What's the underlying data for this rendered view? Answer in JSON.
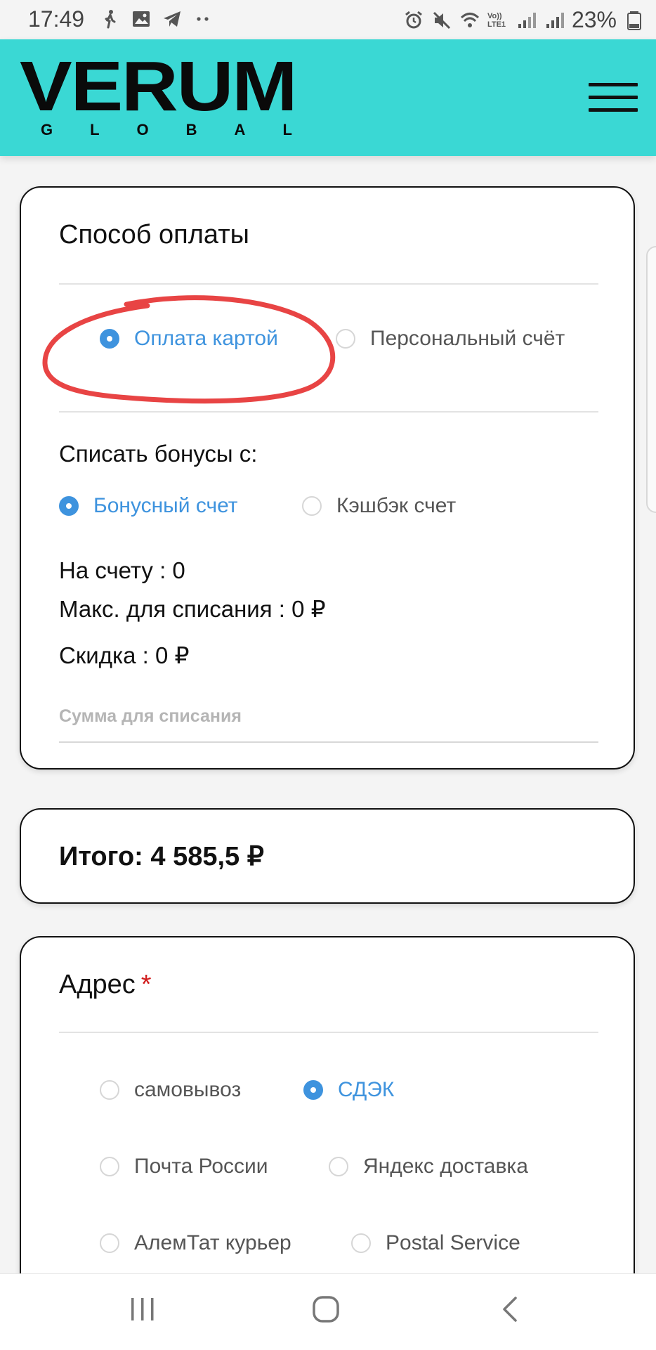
{
  "status_bar": {
    "time": "17:49",
    "battery_percent": "23%",
    "left_icons": [
      "walking-icon",
      "image-icon",
      "telegram-icon",
      "more-dots-icon"
    ],
    "right_icons": [
      "alarm-icon",
      "mute-icon",
      "wifi-icon",
      "volte-icon",
      "signal-icon",
      "signal-icon",
      "battery-icon"
    ],
    "volte_text": "Vo)) LTE1"
  },
  "header": {
    "brand": "VERUM",
    "brand_sub": "GLOBAL",
    "menu_icon": "hamburger-icon",
    "bg_color": "#3ad8d4"
  },
  "payment": {
    "title": "Способ оплаты",
    "methods": [
      {
        "label": "Оплата картой",
        "checked": true
      },
      {
        "label": "Персональный счёт",
        "checked": false
      }
    ],
    "bonus_title": "Списать бонусы с:",
    "bonus_sources": [
      {
        "label": "Бонусный счет",
        "checked": true
      },
      {
        "label": "Кэшбэк счет",
        "checked": false
      }
    ],
    "on_account": "На счету : 0",
    "max_write_off": "Макс. для списания : 0 ₽",
    "discount": "Скидка : 0 ₽",
    "amount_placeholder": "Сумма для списания"
  },
  "total": {
    "label": "Итого: 4 585,5 ₽"
  },
  "address": {
    "title": "Адрес",
    "required_mark": "*",
    "delivery_options": [
      {
        "label": "самовывоз",
        "checked": false
      },
      {
        "label": "СДЭК",
        "checked": true
      },
      {
        "label": "Почта России",
        "checked": false
      },
      {
        "label": "Яндекс доставка",
        "checked": false
      },
      {
        "label": "АлемТат курьер",
        "checked": false
      },
      {
        "label": "Postal Service",
        "checked": false
      }
    ]
  },
  "colors": {
    "accent": "#3e93de",
    "annotation": "#e53030",
    "required": "#d11d1d"
  },
  "nav_bar": {
    "buttons": [
      "recents-icon",
      "home-icon",
      "back-icon"
    ]
  }
}
